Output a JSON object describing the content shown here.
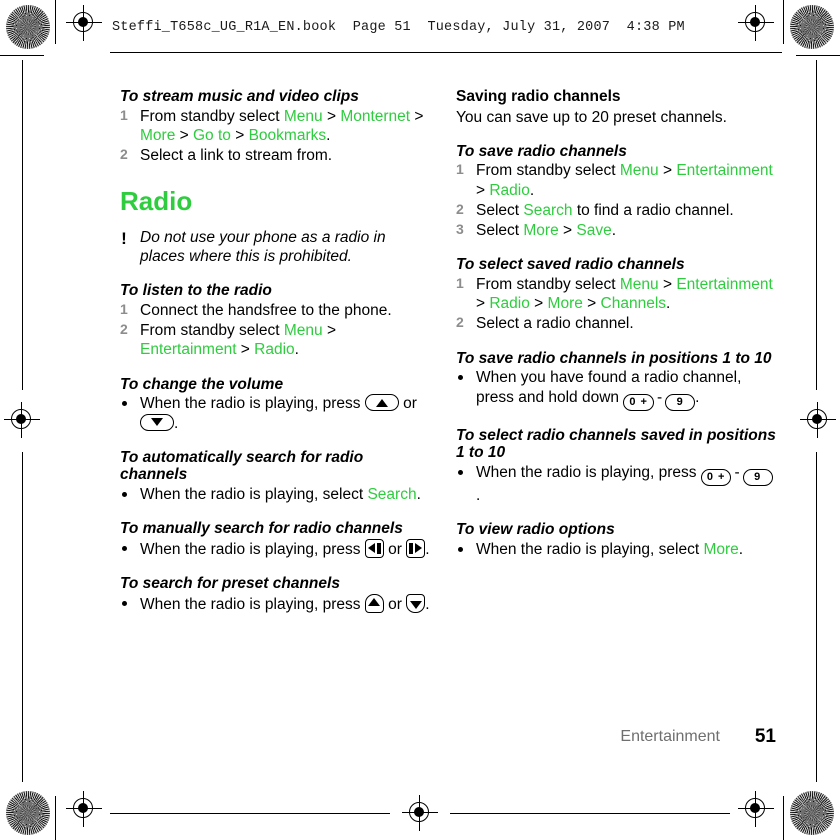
{
  "header": {
    "text": "Steffi_T658c_UG_R1A_EN.book  Page 51  Tuesday, July 31, 2007  4:38 PM"
  },
  "accent_color": "#2fcc3f",
  "left_column": {
    "stream_task": {
      "title": "To stream music and video clips",
      "steps": [
        {
          "num": "1",
          "parts": [
            {
              "t": "From standby select ",
              "ui": false
            },
            {
              "t": "Menu",
              "ui": true
            },
            {
              "t": " > ",
              "ui": false
            },
            {
              "t": "Monternet",
              "ui": true
            },
            {
              "t": " > ",
              "ui": false
            },
            {
              "t": "More",
              "ui": true
            },
            {
              "t": " > ",
              "ui": false
            },
            {
              "t": "Go to",
              "ui": true
            },
            {
              "t": " > ",
              "ui": false
            },
            {
              "t": "Bookmarks",
              "ui": true
            },
            {
              "t": ".",
              "ui": false
            }
          ]
        },
        {
          "num": "2",
          "parts": [
            {
              "t": "Select a link to stream from.",
              "ui": false
            }
          ]
        }
      ]
    },
    "radio_heading": "Radio",
    "caution": {
      "icon": "exclamation-icon",
      "text": "Do not use your phone as a radio in places where this is prohibited."
    },
    "listen_task": {
      "title": "To listen to the radio",
      "steps": [
        {
          "num": "1",
          "parts": [
            {
              "t": "Connect the handsfree to the phone.",
              "ui": false
            }
          ]
        },
        {
          "num": "2",
          "parts": [
            {
              "t": "From standby select ",
              "ui": false
            },
            {
              "t": "Menu",
              "ui": true
            },
            {
              "t": " > ",
              "ui": false
            },
            {
              "t": "Entertainment",
              "ui": true
            },
            {
              "t": " > ",
              "ui": false
            },
            {
              "t": "Radio",
              "ui": true
            },
            {
              "t": ".",
              "ui": false
            }
          ]
        }
      ]
    },
    "volume_task": {
      "title": "To change the volume",
      "lead": "When the radio is playing, press ",
      "mid": " or ",
      "end": ".",
      "key_up": "volume-up-key",
      "key_down": "volume-down-key"
    },
    "auto_search_task": {
      "title": "To automatically search for radio channels",
      "parts": [
        {
          "t": "When the radio is playing, select ",
          "ui": false
        },
        {
          "t": "Search",
          "ui": true
        },
        {
          "t": ".",
          "ui": false
        }
      ]
    },
    "manual_search_task": {
      "title": "To manually search for radio channels",
      "lead": "When the radio is playing, press ",
      "mid": " or ",
      "end": ".",
      "key_left": "nav-left-key",
      "key_right": "nav-right-key"
    },
    "preset_search_task": {
      "title": "To search for preset channels",
      "lead": "When the radio is playing, press ",
      "mid": " or ",
      "end": ".",
      "key_up": "nav-up-key",
      "key_down": "nav-down-key"
    }
  },
  "right_column": {
    "saving_heading": "Saving radio channels",
    "saving_intro": "You can save up to 20 preset channels.",
    "save_task": {
      "title": "To save radio channels",
      "steps": [
        {
          "num": "1",
          "parts": [
            {
              "t": "From standby select ",
              "ui": false
            },
            {
              "t": "Menu",
              "ui": true
            },
            {
              "t": " > ",
              "ui": false
            },
            {
              "t": "Entertainment",
              "ui": true
            },
            {
              "t": " > ",
              "ui": false
            },
            {
              "t": "Radio",
              "ui": true
            },
            {
              "t": ".",
              "ui": false
            }
          ]
        },
        {
          "num": "2",
          "parts": [
            {
              "t": "Select ",
              "ui": false
            },
            {
              "t": "Search",
              "ui": true
            },
            {
              "t": " to find a radio channel.",
              "ui": false
            }
          ]
        },
        {
          "num": "3",
          "parts": [
            {
              "t": "Select ",
              "ui": false
            },
            {
              "t": "More",
              "ui": true
            },
            {
              "t": " > ",
              "ui": false
            },
            {
              "t": "Save",
              "ui": true
            },
            {
              "t": ".",
              "ui": false
            }
          ]
        }
      ]
    },
    "select_saved_task": {
      "title": "To select saved radio channels",
      "steps": [
        {
          "num": "1",
          "parts": [
            {
              "t": "From standby select ",
              "ui": false
            },
            {
              "t": "Menu",
              "ui": true
            },
            {
              "t": " > ",
              "ui": false
            },
            {
              "t": "Entertainment",
              "ui": true
            },
            {
              "t": " > ",
              "ui": false
            },
            {
              "t": "Radio",
              "ui": true
            },
            {
              "t": " > ",
              "ui": false
            },
            {
              "t": "More",
              "ui": true
            },
            {
              "t": " > ",
              "ui": false
            },
            {
              "t": "Channels",
              "ui": true
            },
            {
              "t": ".",
              "ui": false
            }
          ]
        },
        {
          "num": "2",
          "parts": [
            {
              "t": "Select a radio channel.",
              "ui": false
            }
          ]
        }
      ]
    },
    "save_positions_task": {
      "title": "To save radio channels in positions 1 to 10",
      "lead": "When you have found a radio channel, press and hold down ",
      "end": ".",
      "key_zero_label": "0 +",
      "key_nine_label": "9",
      "range_dash": "-"
    },
    "select_positions_task": {
      "title": "To select radio channels saved in positions 1 to 10",
      "lead": "When the radio is playing, press ",
      "end": ".",
      "key_zero_label": "0 +",
      "key_nine_label": "9",
      "range_dash": "-"
    },
    "view_options_task": {
      "title": "To view radio options",
      "parts": [
        {
          "t": "When the radio is playing, select ",
          "ui": false
        },
        {
          "t": "More",
          "ui": true
        },
        {
          "t": ".",
          "ui": false
        }
      ]
    }
  },
  "footer": {
    "chapter": "Entertainment",
    "page": "51"
  }
}
